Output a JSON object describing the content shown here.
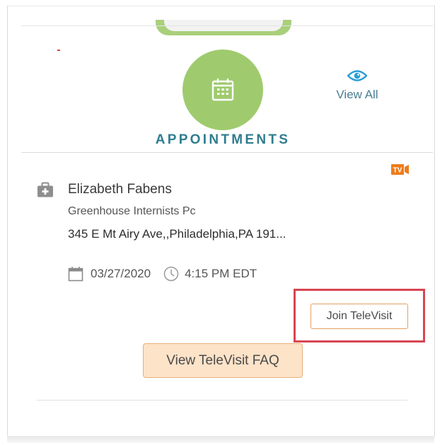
{
  "widget": {
    "title": "APPOINTMENTS",
    "view_all_label": "View All",
    "icons": {
      "main": "calendar-icon",
      "view_all": "eye-icon",
      "televisit_badge": "tv-video-icon"
    }
  },
  "appointment": {
    "provider_name": "Elizabeth Fabens",
    "practice": "Greenhouse Internists Pc",
    "address": "345 E Mt Airy Ave,,Philadelphia,PA 191...",
    "date": "03/27/2020",
    "time": "4:15 PM EDT",
    "badge_label": "TV",
    "join_label": "Join TeleVisit"
  },
  "faq_button_label": "View TeleVisit FAQ",
  "colors": {
    "accent_green": "#9fcb6e",
    "title_teal": "#2f7d8f",
    "eye_blue": "#2a9fd6",
    "badge_orange": "#ef7c1a",
    "button_orange_border": "#e3a061",
    "faq_fill": "#fde3c8",
    "highlight_red": "#d94552"
  }
}
